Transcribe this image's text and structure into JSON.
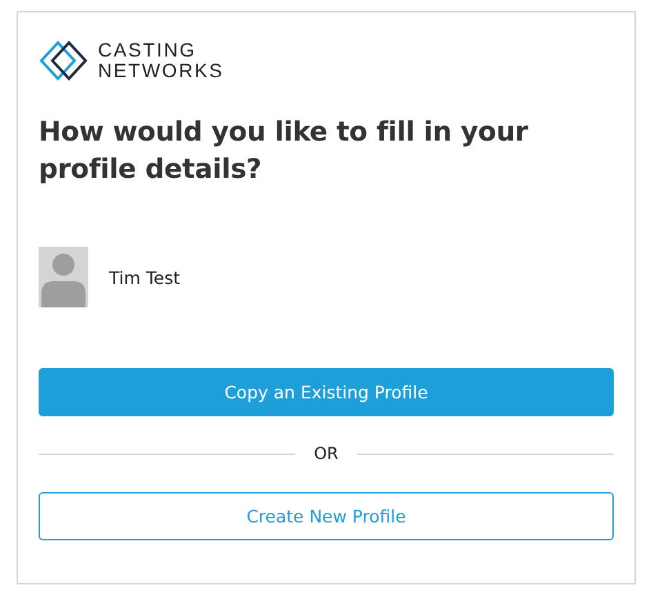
{
  "logo": {
    "line_1": "CASTING",
    "line_2": "NETWORKS"
  },
  "heading": "How would you like to fill in your profile details?",
  "profile": {
    "name": "Tim Test"
  },
  "actions": [
    {
      "label": "Copy an Existing Profile",
      "kind": "primary"
    },
    {
      "label": "Create New Profile",
      "kind": "secondary"
    }
  ],
  "divider_label": "OR"
}
